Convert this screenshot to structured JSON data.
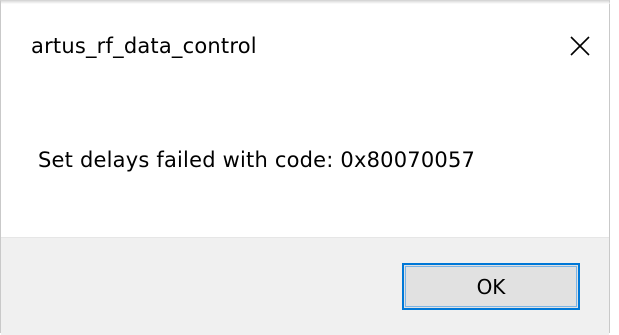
{
  "dialog": {
    "title": "artus_rf_data_control",
    "close_icon": "close-icon",
    "message": "Set delays failed with code: 0x80070057",
    "ok_label": "OK"
  },
  "colors": {
    "footer_bg": "#f0f0f0",
    "button_bg": "#e1e1e1",
    "button_focus_border": "#0078d7"
  }
}
